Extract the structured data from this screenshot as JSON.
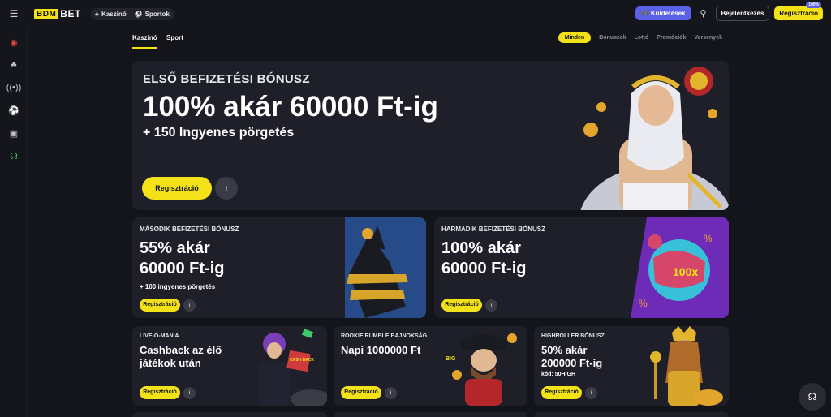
{
  "header": {
    "menu_icon": "hamburger-icon",
    "logo_box": "BDM",
    "logo_text": "BET",
    "nav": [
      {
        "label": "Kaszinó",
        "icon": "cherries-icon"
      },
      {
        "label": "Sportok",
        "icon": "soccer-ball-icon"
      }
    ],
    "missions_label": "Küldetések",
    "login_label": "Bejelentkezés",
    "register_label": "Regisztráció",
    "register_badge": "100%"
  },
  "rail": [
    {
      "icon": "target-icon"
    },
    {
      "icon": "cherries-icon"
    },
    {
      "icon": "live-broadcast-icon"
    },
    {
      "icon": "soccer-ball-icon"
    },
    {
      "icon": "gamepad-icon"
    },
    {
      "icon": "headset-icon"
    }
  ],
  "tabs": [
    {
      "label": "Kaszinó",
      "active": true
    },
    {
      "label": "Sport",
      "active": false
    }
  ],
  "filters": [
    "Minden",
    "Bónuszok",
    "Lottó",
    "Promóciók",
    "Versenyek"
  ],
  "hero": {
    "subtitle": "ELSŐ BEFIZETÉSI BÓNUSZ",
    "title": "100% akár 60000 Ft-ig",
    "extra": "+ 150 Ingyenes pörgetés",
    "button": "Regisztráció",
    "info": "i"
  },
  "mid_cards": [
    {
      "subtitle": "MÁSODIK BEFIZETÉSI BÓNUSZ",
      "title_line1": "55% akár",
      "title_line2": "60000 Ft-ig",
      "extra": "+ 100 ingyenes pörgetés",
      "button": "Regisztráció",
      "info": "i"
    },
    {
      "subtitle": "HARMADIK BEFIZETÉSI BÓNUSZ",
      "title_line1": "100% akár",
      "title_line2": "60000 Ft-ig",
      "extra": "",
      "button": "Regisztráció",
      "info": "i",
      "art_text": "100x"
    }
  ],
  "small_cards": [
    {
      "subtitle": "LIVE-O-MANIA",
      "title_line1": "Cashback az élő",
      "title_line2": "játékok után",
      "code": "",
      "button": "Regisztráció",
      "info": "i",
      "art_text": "CASH BACK"
    },
    {
      "subtitle": "ROOKIE RUMBLE BAJNOKSÁG",
      "title_line1": "Napi 1000000 Ft",
      "title_line2": "",
      "code": "",
      "button": "Regisztráció",
      "info": "i",
      "art_text": "BIG"
    },
    {
      "subtitle": "HIGHROLLER BÓNUSZ",
      "title_line1": "50% akár",
      "title_line2": "200000 Ft-ig",
      "code": "kód: 50HIGH",
      "button": "Regisztráció",
      "info": "i"
    }
  ],
  "colors": {
    "accent": "#f3e218",
    "card": "#1e1f29",
    "bg": "#14151b",
    "purple": "#5c62e8"
  }
}
